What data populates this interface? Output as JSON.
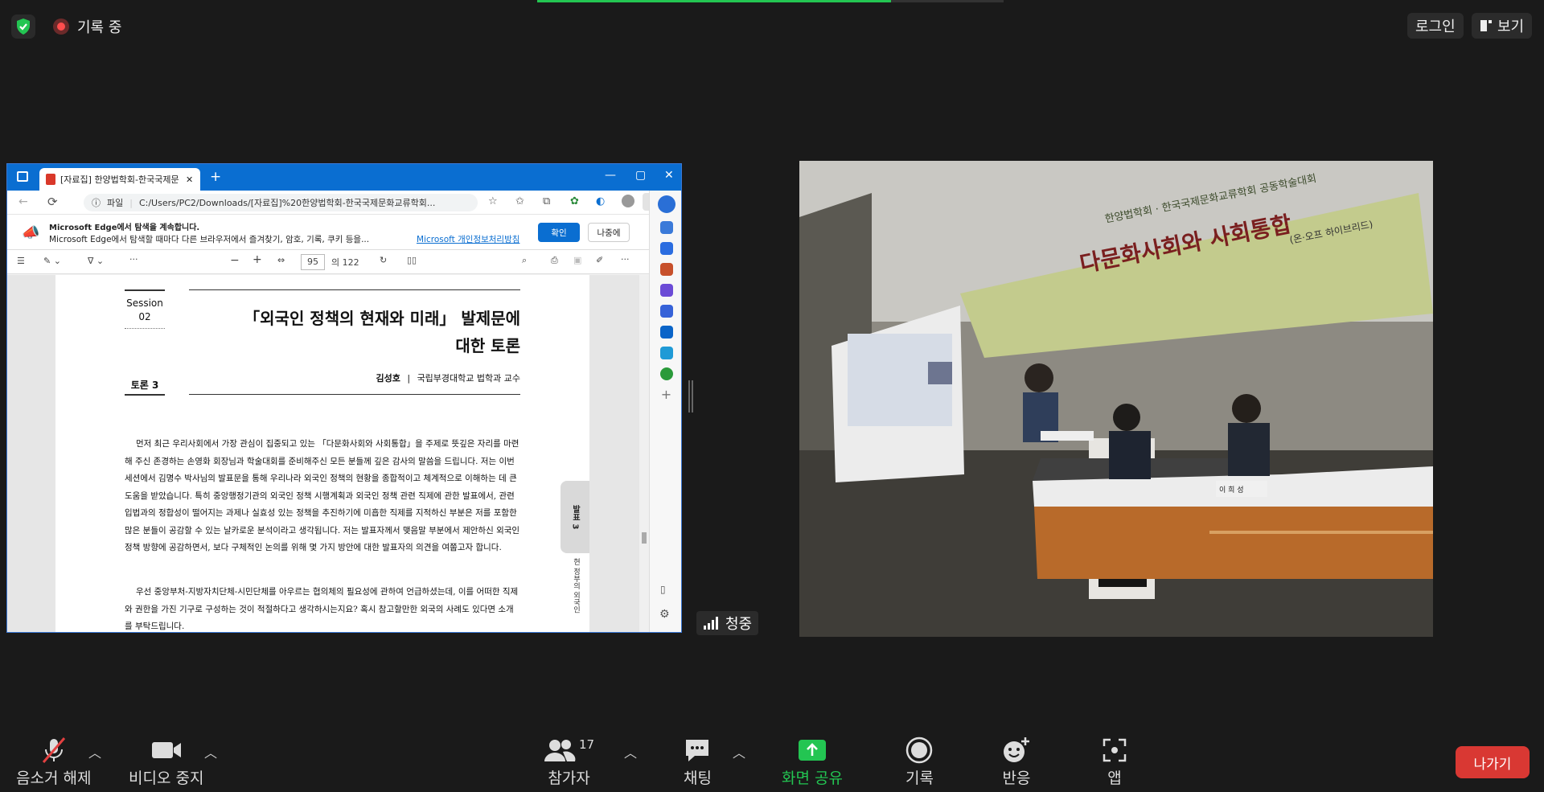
{
  "topbar": {
    "recording": "기록 중",
    "login": "로그인",
    "view": "보기"
  },
  "browser": {
    "tab_title": "[자료집] 한양법학회-한국국제문",
    "url_prefix": "파일",
    "url": "C:/Users/PC2/Downloads/[자료집]%20한양법학회-한국국제문화교류학회...",
    "notice_title": "Microsoft Edge에서 탐색을 계속합니다.",
    "notice_body": "Microsoft Edge에서 탐색할 때마다 다른 브라우저에서 즐겨찾기, 암호, 기록, 쿠키 등을...",
    "notice_link": "Microsoft 개인정보처리방침",
    "confirm": "확인",
    "later": "나중에",
    "page_current": "95",
    "page_total": "의 122"
  },
  "pdf": {
    "session": "Session",
    "session_no": "02",
    "title_line1": "「외국인 정책의 현재와 미래」 발제문에",
    "title_line2": "대한 토론",
    "discussion": "토론 3",
    "author": "김성호",
    "affiliation": "국립부경대학교 법학과 교수",
    "para1": "먼저 최근 우리사회에서 가장 관심이 집중되고 있는 「다문화사회와 사회통합」을 주제로 뜻깊은 자리를 마련해 주신 존경하는 손영화 회장님과 학술대회를 준비해주신 모든 분들께 깊은 감사의 말씀을 드립니다. 저는 이번 세션에서 김명수 박사님의 발표문을 통해 우리나라 외국인 정책의 현황을 종합적이고 체계적으로 이해하는 데 큰 도움을 받았습니다. 특히 중앙행정기관의 외국인 정책 시행계획과 외국인 정책 관련 직제에 관한 발표에서, 관련 입법과의 정합성이 떨어지는 과제나 실효성 있는 정책을 추진하기에 미흡한 직제를 지적하신 부분은 저를 포함한 많은 분들이 공감할 수 있는 날카로운 분석이라고 생각됩니다. 저는 발표자께서 맺음말 부분에서 제안하신 외국인 정책 방향에 공감하면서, 보다 구체적인 논의를 위해 몇 가지 방안에 대한 발표자의 의견을 여쭙고자 합니다.",
    "para2": "우선 중앙부처-지방자치단체-시민단체를 아우르는 협의체의 필요성에 관하여 언급하셨는데, 이를 어떠한 직제와 권한을 가진 기구로 구성하는 것이 적절하다고 생각하시는지요? 혹시 참고할만한 외국의 사례도 있다면 소개를 부탁드립니다.",
    "side_tab": "발표 3",
    "side_text": "현 정부의 외국인"
  },
  "video": {
    "banner_small": "한양법학회 · 한국국제문화교류학회 공동학술대회",
    "banner_big": "다문화사회와 사회통합",
    "banner_sub": "(온·오프 하이브리드)",
    "speaker_label": "청중",
    "nameplate": "이 희 성"
  },
  "toolbar": {
    "mute": "음소거 해제",
    "video": "비디오 중지",
    "participants": "참가자",
    "participants_count": "17",
    "chat": "채팅",
    "share": "화면 공유",
    "record": "기록",
    "react": "반응",
    "apps": "앱",
    "leave": "나가기"
  },
  "colors": {
    "share_green": "#23c552",
    "leave_red": "#d93833",
    "edge_blue": "#0a6ed1"
  }
}
